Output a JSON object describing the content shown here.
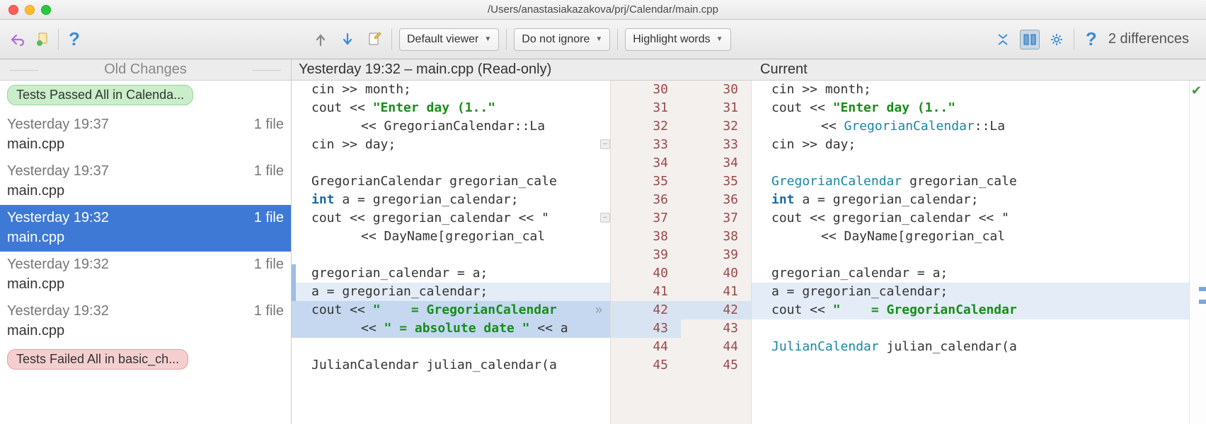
{
  "window": {
    "title": "/Users/anastasiakazakova/prj/Calendar/main.cpp"
  },
  "toolbar": {
    "viewer_mode": "Default viewer",
    "ignore_mode": "Do not ignore",
    "highlight_mode": "Highlight words",
    "diff_count": "2 differences"
  },
  "sidebar": {
    "header": "Old Changes",
    "badge_pass": "Tests Passed All in Calenda...",
    "badge_fail": "Tests Failed All in basic_ch...",
    "items": [
      {
        "time": "Yesterday 19:37",
        "files": "1 file",
        "name": "main.cpp"
      },
      {
        "time": "Yesterday 19:37",
        "files": "1 file",
        "name": "main.cpp"
      },
      {
        "time": "Yesterday 19:32",
        "files": "1 file",
        "name": "main.cpp"
      },
      {
        "time": "Yesterday 19:32",
        "files": "1 file",
        "name": "main.cpp"
      },
      {
        "time": "Yesterday 19:32",
        "files": "1 file",
        "name": "main.cpp"
      }
    ]
  },
  "subheader": {
    "left_title": "Yesterday 19:32 – main.cpp (Read-only)",
    "right_title": "Current"
  },
  "gutter": {
    "left": [
      "30",
      "31",
      "32",
      "33",
      "34",
      "35",
      "36",
      "37",
      "38",
      "39",
      "40",
      "41",
      "42",
      "43",
      "44",
      "45"
    ],
    "right": [
      "30",
      "31",
      "32",
      "33",
      "34",
      "35",
      "36",
      "37",
      "38",
      "39",
      "40",
      "41",
      "42",
      "43",
      "44",
      "45"
    ]
  },
  "code_left": {
    "l0": "cin >> month;",
    "l1a": "cout << ",
    "l1b": "\"Enter day (1..\"",
    "l2a": "<< GregorianCalendar::La",
    "l3": "cin >> day;",
    "l4": "",
    "l5a": "GregorianCalendar gregorian_cale",
    "l6a": "int",
    "l6b": " a = gregorian_calendar;",
    "l7": "cout << gregorian_calendar << \" ",
    "l8": "<< DayName[gregorian_cal",
    "l9": "",
    "l10": "gregorian_calendar = a;",
    "l11": "a = gregorian_calendar;",
    "l12a": "cout << ",
    "l12b": "\"    = GregorianCalendar",
    "l13a": "<< ",
    "l13b": "\" = absolute date \"",
    "l13c": " << a",
    "l14": "",
    "l15": "JulianCalendar julian_calendar(a"
  },
  "code_right": {
    "l0": "cin >> month;",
    "l1a": "cout << ",
    "l1b": "\"Enter day (1..\"",
    "l2a": "<< ",
    "l2b": "GregorianCalendar",
    "l2c": "::La",
    "l3": "cin >> day;",
    "l4": "",
    "l5a": "GregorianCalendar",
    "l5b": " gregorian_cale",
    "l6a": "int",
    "l6b": " a = gregorian_calendar;",
    "l7": "cout << gregorian_calendar << \" ",
    "l8": "<< DayName[gregorian_cal",
    "l9": "",
    "l10": "gregorian_calendar = a;",
    "l11": "a = gregorian_calendar;",
    "l12a": "cout << ",
    "l12b": "\"    = GregorianCalendar",
    "l13": "",
    "l14a": "JulianCalendar",
    "l14b": " julian_calendar(a",
    "l15": ""
  }
}
